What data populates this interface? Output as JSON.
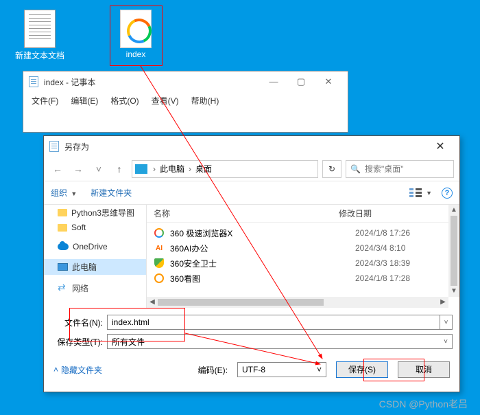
{
  "desktop": {
    "txt_doc_label": "新建文本文档",
    "index_label": "index"
  },
  "notepad": {
    "title": "index - 记事本",
    "menu": {
      "file": "文件(F)",
      "edit": "编辑(E)",
      "format": "格式(O)",
      "view": "查看(V)",
      "help": "帮助(H)"
    }
  },
  "save_dialog": {
    "title": "另存为",
    "breadcrumbs": {
      "pc": "此电脑",
      "desktop": "桌面"
    },
    "search_placeholder": "搜索\"桌面\"",
    "organize": "组织",
    "new_folder": "新建文件夹",
    "columns": {
      "name": "名称",
      "date": "修改日期"
    },
    "tree": {
      "py3": "Python3思维导图",
      "soft": "Soft",
      "onedrive": "OneDrive",
      "this_pc": "此电脑",
      "network": "网络"
    },
    "files": [
      {
        "name": "360 极速浏览器X",
        "date": "2024/1/8 17:26",
        "icon": "360"
      },
      {
        "name": "360AI办公",
        "date": "2024/3/4 8:10",
        "icon": "ai"
      },
      {
        "name": "360安全卫士",
        "date": "2024/3/3 18:39",
        "icon": "shield"
      },
      {
        "name": "360看图",
        "date": "2024/1/8 17:28",
        "icon": "o"
      }
    ],
    "filename_label": "文件名(N):",
    "filetype_label": "保存类型(T):",
    "filename_value": "index.html",
    "filetype_value": "所有文件",
    "hide_folders": "隐藏文件夹",
    "encoding_label": "编码(E):",
    "encoding_value": "UTF-8",
    "save_btn": "保存(S)",
    "cancel_btn": "取消"
  },
  "watermark": "CSDN @Python老吕"
}
